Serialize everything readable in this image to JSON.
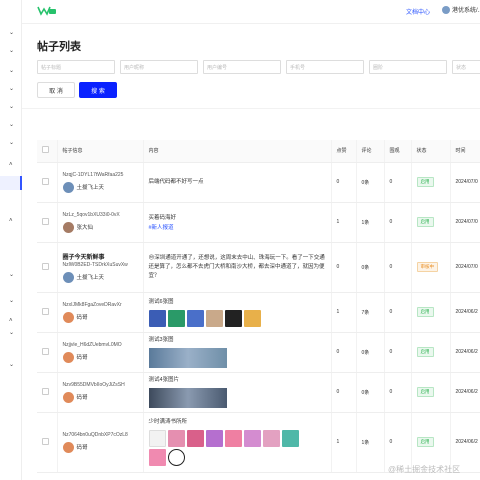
{
  "header": {
    "doc_center": "文档中心",
    "user_name": "港优系统/..."
  },
  "page": {
    "title": "帖子列表"
  },
  "filters": {
    "post_id": "帖子标题",
    "post_name": "用户昵称",
    "user_id": "用户编号",
    "phone": "手机号",
    "circle": "圈阶",
    "status": "状态"
  },
  "buttons": {
    "cancel": "取 消",
    "search": "搜 索"
  },
  "table": {
    "headers": [
      "",
      "帖子信息",
      "内容",
      "点赞",
      "评论",
      "围观",
      "状态",
      "时间"
    ],
    "rows": [
      {
        "id": "NzqjC-1DYL17tWaRfaa225",
        "title": "",
        "user": "土拔飞上天",
        "content": "后端代码都不好写一点",
        "tag": "",
        "likes": "0",
        "comments": "0条",
        "views": "0",
        "status": "启用",
        "time": "2024/07/0"
      },
      {
        "id": "NzLz_5qov1bXU33i0-0vX",
        "title": "",
        "user": "张大仙",
        "content": "买着码海好",
        "tag": "#新人报道",
        "likes": "1",
        "comments": "1条",
        "views": "0",
        "status": "启用",
        "time": "2024/07/0"
      },
      {
        "id": "NzlW0B2ED-TSDrkXuSuvXw",
        "title": "圈子今天新鲜事",
        "user": "土拔飞上天",
        "content": "😔深圳通道开通了，还想说，这周末去中山、珠海玩一下。看了一下交通还是算了，怎么都不去虎门大桥和南沙大桥，都去深中通道了，就因为便宜？",
        "tag": "",
        "likes": "0",
        "comments": "0条",
        "views": "0",
        "status": "审核中",
        "time": "2024/07/0"
      },
      {
        "id": "NzxIJMk8FgaZoveDRavXr",
        "title": "",
        "user": "码哥",
        "content": "测试6张图",
        "tag": "",
        "likes": "1",
        "comments": "7条",
        "views": "0",
        "status": "启用",
        "time": "2024/06/2"
      },
      {
        "id": "Nzjjvle_H6dZUebmvL0MO",
        "title": "",
        "user": "码哥",
        "content": "测试3张图",
        "tag": "",
        "likes": "0",
        "comments": "0条",
        "views": "0",
        "status": "启用",
        "time": "2024/06/2"
      },
      {
        "id": "Nzv9B55DMVbIIoOyJiZsSH",
        "title": "",
        "user": "码哥",
        "content": "测试4张图片",
        "tag": "",
        "likes": "0",
        "comments": "0条",
        "views": "0",
        "status": "启用",
        "time": "2024/06/2"
      },
      {
        "id": "Nz7064bn0uQDnbXP7cOzL8",
        "title": "",
        "user": "码哥",
        "content": "少时满涛书所所",
        "tag": "",
        "likes": "1",
        "comments": "1条",
        "views": "0",
        "status": "启用",
        "time": "2024/06/2"
      }
    ]
  },
  "watermark": "@稀土掘金技术社区"
}
